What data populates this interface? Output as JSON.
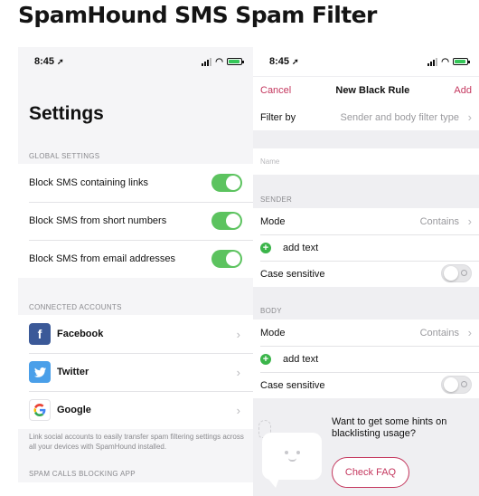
{
  "headline": "SpamHound SMS Spam Filter",
  "colors": {
    "accent": "#c4375e",
    "toggle_on": "#5cc35f",
    "plus": "#3bb54a"
  },
  "left": {
    "status": {
      "time": "8:45"
    },
    "title": "Settings",
    "global_header": "GLOBAL SETTINGS",
    "global_items": [
      {
        "label": "Block SMS containing links",
        "on": true
      },
      {
        "label": "Block SMS from short numbers",
        "on": true
      },
      {
        "label": "Block SMS from email addresses",
        "on": true
      }
    ],
    "accounts_header": "CONNECTED ACCOUNTS",
    "accounts": [
      {
        "label": "Facebook",
        "icon": "facebook-icon",
        "color": "#3b5998"
      },
      {
        "label": "Twitter",
        "icon": "twitter-icon",
        "color": "#4a9fe9"
      },
      {
        "label": "Google",
        "icon": "google-icon",
        "color": "#ffffff"
      }
    ],
    "accounts_footnote": "Link social accounts to easily transfer spam filtering settings across all your devices with SpamHound installed.",
    "calls_header": "SPAM CALLS BLOCKING APP"
  },
  "right": {
    "status": {
      "time": "8:45"
    },
    "nav": {
      "cancel": "Cancel",
      "title": "New Black Rule",
      "add": "Add"
    },
    "filter_by": {
      "label": "Filter by",
      "value": "Sender and body filter type"
    },
    "name_placeholder": "Name",
    "sender": {
      "header": "SENDER",
      "mode_label": "Mode",
      "mode_value": "Contains",
      "add_text": "add text",
      "case_label": "Case sensitive",
      "case_on": false
    },
    "body": {
      "header": "BODY",
      "mode_label": "Mode",
      "mode_value": "Contains",
      "add_text": "add text",
      "case_label": "Case sensitive",
      "case_on": false
    },
    "hint_text": "Want to get some hints on blacklisting usage?",
    "faq_button": "Check FAQ"
  }
}
